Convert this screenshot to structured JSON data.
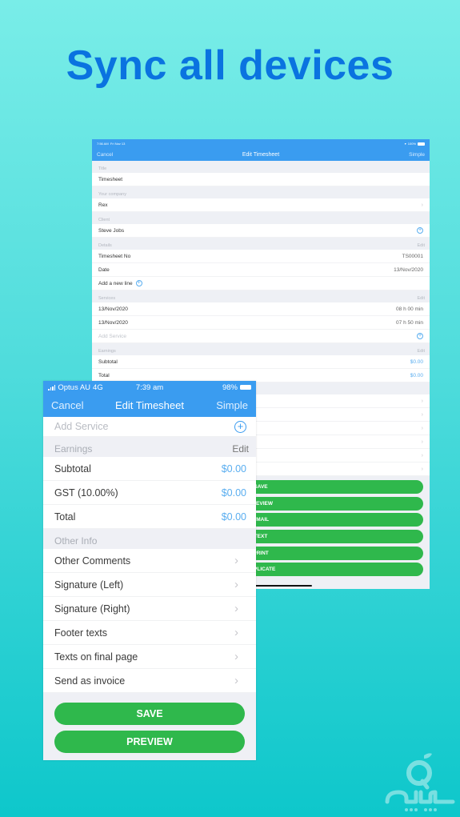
{
  "headline": "Sync all devices",
  "tablet": {
    "status": {
      "time": "7:56 AM",
      "date": "Fri Nov 13",
      "battery": "100%"
    },
    "nav": {
      "cancel": "Cancel",
      "title": "Edit Timesheet",
      "simple": "Simple"
    },
    "title_section": {
      "label": "Title",
      "value": "Timesheet"
    },
    "company_section": {
      "label": "Your company",
      "value": "Rex"
    },
    "client_section": {
      "label": "Client",
      "value": "Steve Jobs"
    },
    "details_section": {
      "label": "Details",
      "edit": "Edit",
      "rows": [
        {
          "label": "Timesheet No",
          "value": "TS00001"
        },
        {
          "label": "Date",
          "value": "13/Nov/2020"
        }
      ],
      "add_line": "Add a new line"
    },
    "services_section": {
      "label": "Services",
      "edit": "Edit",
      "rows": [
        {
          "date": "13/Nov/2020",
          "duration": "08 h 00 min"
        },
        {
          "date": "13/Nov/2020",
          "duration": "07 h 50 min"
        }
      ],
      "add_service": "Add Service"
    },
    "earnings_section": {
      "label": "Earnings",
      "edit": "Edit",
      "rows": [
        {
          "label": "Subtotal",
          "value": "$0.00"
        },
        {
          "label": "Total",
          "value": "$0.00"
        }
      ]
    },
    "buttons": [
      "SAVE",
      "PREVIEW",
      "EMAIL",
      "TEXT",
      "PRINT",
      "DUPLICATE"
    ]
  },
  "phone": {
    "status": {
      "carrier": "Optus AU",
      "network": "4G",
      "time": "7:39 am",
      "battery": "98%"
    },
    "nav": {
      "cancel": "Cancel",
      "title": "Edit Timesheet",
      "simple": "Simple"
    },
    "add_service": "Add Service",
    "earnings_section": {
      "label": "Earnings",
      "edit": "Edit",
      "rows": [
        {
          "label": "Subtotal",
          "value": "$0.00"
        },
        {
          "label": "GST (10.00%)",
          "value": "$0.00"
        },
        {
          "label": "Total",
          "value": "$0.00"
        }
      ]
    },
    "other_info_section": {
      "label": "Other Info",
      "rows": [
        "Other Comments",
        "Signature (Left)",
        "Signature (Right)",
        "Footer texts",
        "Texts on final page",
        "Send as invoice"
      ]
    },
    "buttons": [
      "SAVE",
      "PREVIEW"
    ]
  },
  "colors": {
    "accent": "#3a9cf0",
    "headline": "#0a73e0",
    "button": "#2fb84c",
    "money": "#5aaef0"
  },
  "icons": {
    "add": "plus-circle-icon",
    "chevron": "chevron-right-icon",
    "watermark": "apple-logo-icon"
  }
}
